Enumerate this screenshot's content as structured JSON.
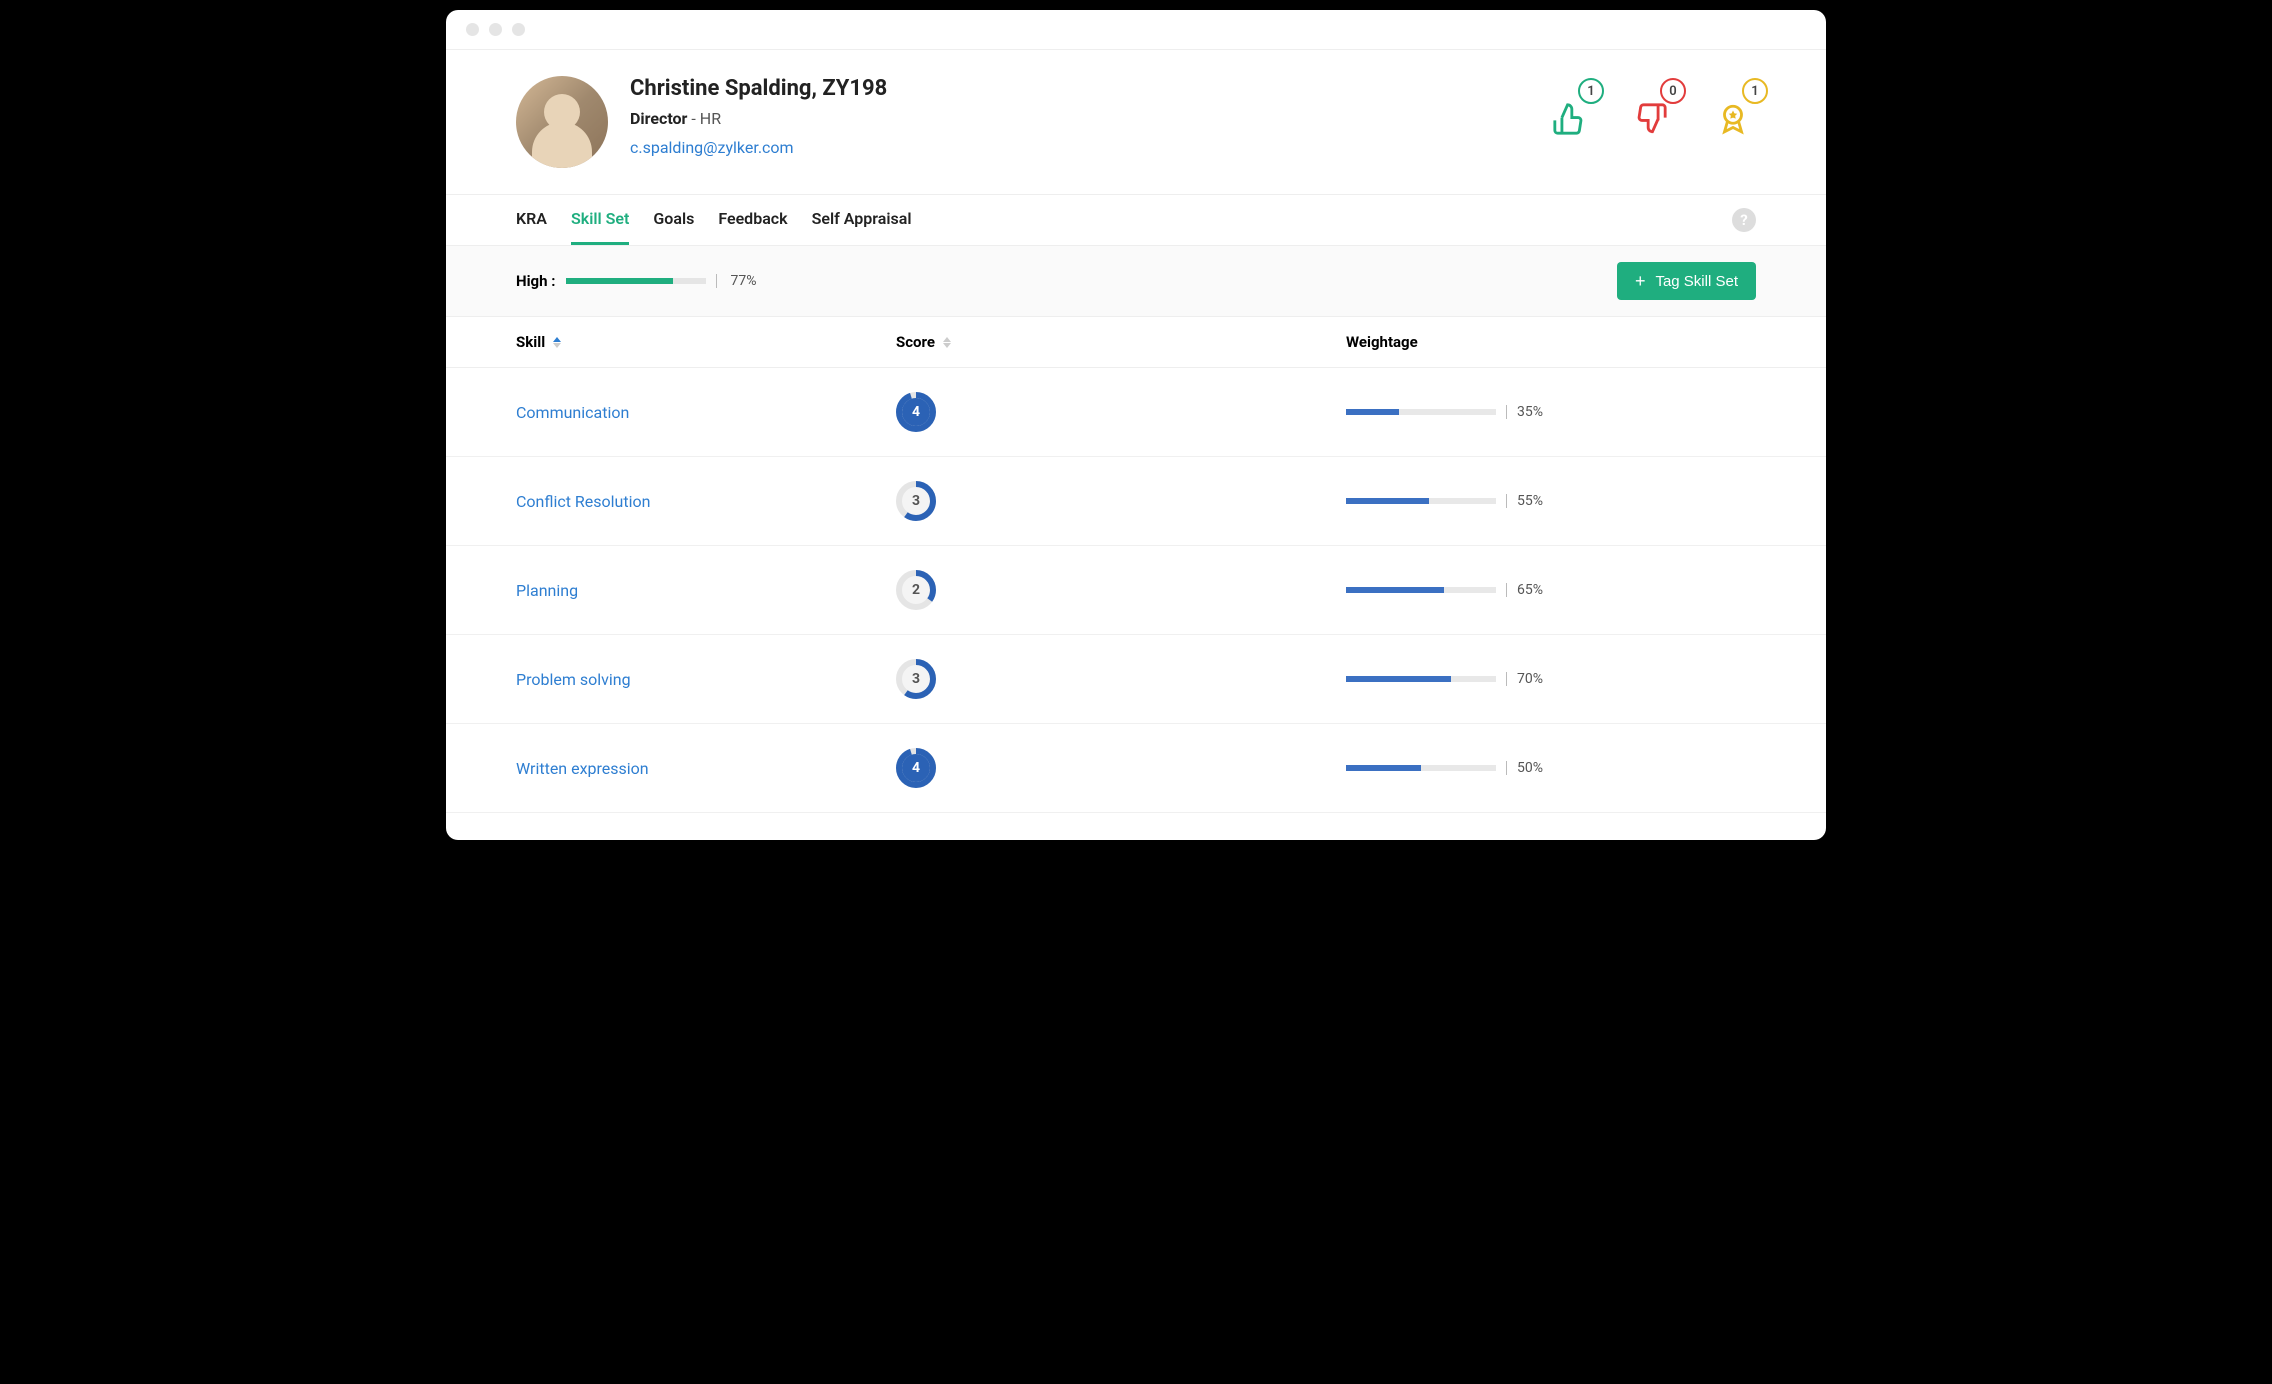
{
  "profile": {
    "name": "Christine Spalding, ZY198",
    "role_title": "Director",
    "role_dept": " - HR",
    "email": "c.spalding@zylker.com"
  },
  "stats": {
    "thumbs_up": "1",
    "thumbs_down": "0",
    "award": "1"
  },
  "tabs": [
    {
      "label": "KRA",
      "active": false
    },
    {
      "label": "Skill Set",
      "active": true
    },
    {
      "label": "Goals",
      "active": false
    },
    {
      "label": "Feedback",
      "active": false
    },
    {
      "label": "Self Appraisal",
      "active": false
    }
  ],
  "high": {
    "label": "High :",
    "percent": 77,
    "percent_text": "77%"
  },
  "tag_button": "Tag Skill Set",
  "columns": {
    "skill": "Skill",
    "score": "Score",
    "weightage": "Weightage"
  },
  "rows": [
    {
      "skill": "Communication",
      "score": "4",
      "score_pct": 95,
      "weight": 35,
      "weight_text": "35%"
    },
    {
      "skill": "Conflict Resolution",
      "score": "3",
      "score_pct": 60,
      "weight": 55,
      "weight_text": "55%"
    },
    {
      "skill": "Planning",
      "score": "2",
      "score_pct": 35,
      "weight": 65,
      "weight_text": "65%"
    },
    {
      "skill": "Problem solving",
      "score": "3",
      "score_pct": 60,
      "weight": 70,
      "weight_text": "70%"
    },
    {
      "skill": "Written expression",
      "score": "4",
      "score_pct": 95,
      "weight": 50,
      "weight_text": "50%"
    }
  ]
}
